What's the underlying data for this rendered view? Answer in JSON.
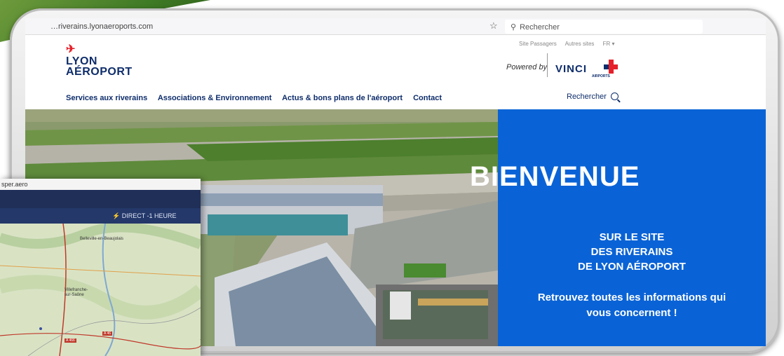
{
  "browser": {
    "url": "…riverains.lyonaeroports.com",
    "search_placeholder": "Rechercher"
  },
  "site": {
    "logo_line1": "LYON",
    "logo_line2": "AÉROPORT",
    "top_links": [
      "Site Passagers",
      "Autres sites",
      "FR ▾"
    ],
    "powered_by": "Powered by",
    "vinci_word": "VINCI",
    "vinci_sub": "AIRPORTS",
    "nav": [
      "Services aux riverains",
      "Associations & Environnement",
      "Actus & bons plans de l'aéroport",
      "Contact"
    ],
    "nav_search": "Rechercher"
  },
  "hero": {
    "title": "BIENVENUE",
    "subtitle_lines": [
      "SUR LE SITE",
      "DES RIVERAINS",
      "DE LYON AÉROPORT"
    ],
    "info_lines": [
      "Retrouvez toutes les informations qui",
      "vous concernent !"
    ]
  },
  "map_window": {
    "url": "sper.aero",
    "direct_label": "⚡ DIRECT -1 HEURE",
    "places": [
      "Belleville-en-Beaujolais",
      "Villefranche-sur-Saône"
    ],
    "roads": [
      "A 46",
      "A 466"
    ]
  },
  "colors": {
    "navy": "#0e2d6b",
    "hero_blue": "#0a63d6",
    "red": "#e5202a",
    "map_header": "#1f2f57"
  }
}
